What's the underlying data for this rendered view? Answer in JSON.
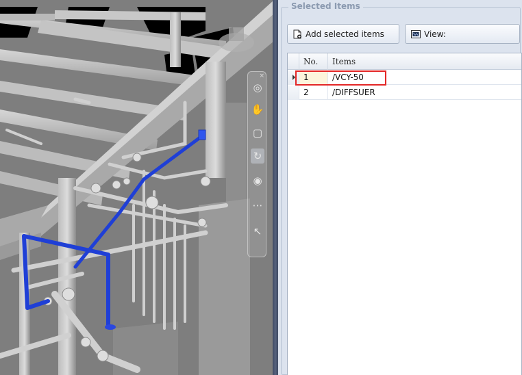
{
  "panel": {
    "title": "Selected Items",
    "add_button_label": "Add selected items",
    "view_button_label": "View:",
    "columns": {
      "no": "No.",
      "items": "Items"
    },
    "rows": [
      {
        "no": "1",
        "item": "/VCY-50",
        "selected": true
      },
      {
        "no": "2",
        "item": "/DIFFSUER",
        "selected": false
      }
    ]
  },
  "viewport": {
    "toolbar_icons": [
      "close-icon",
      "orbit-icon",
      "pan-hand-icon",
      "zoom-box-icon",
      "rotate-icon",
      "look-around-icon",
      "walk-icon",
      "select-pointer-icon"
    ],
    "highlight_color": "#1f3fd6",
    "model_color": "#b7b7b7"
  },
  "colors": {
    "annotation_box": "#e32626",
    "splitter": "#4a5670",
    "panel_bg": "#dce3ee"
  }
}
